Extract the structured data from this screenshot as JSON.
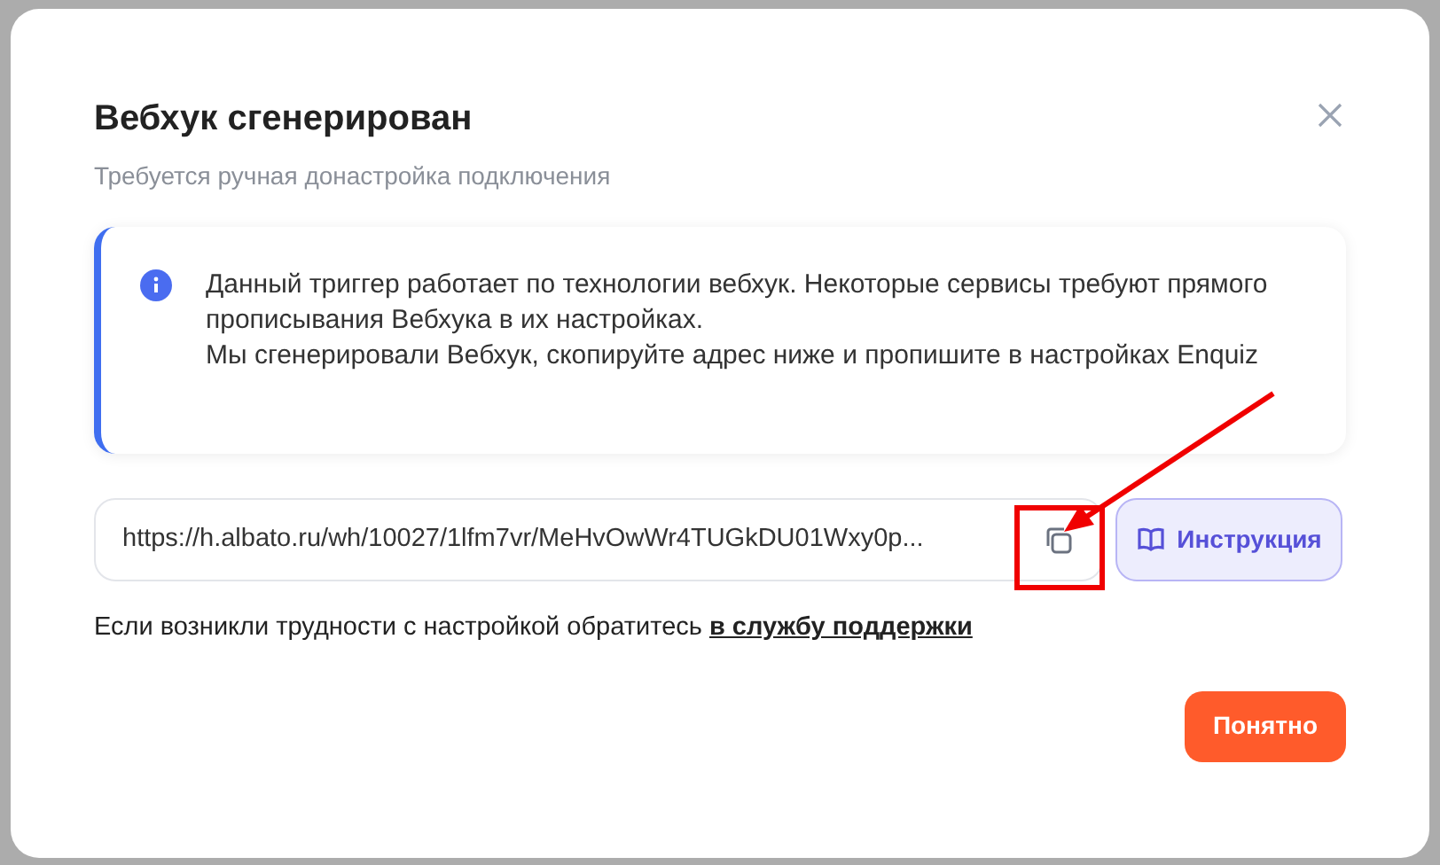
{
  "dialog": {
    "title": "Вебхук сгенерирован",
    "subtitle": "Требуется ручная донастройка подключения",
    "info": {
      "paragraphs": [
        "Данный триггер работает по технологии вебхук. Некоторые сервисы требуют прямого прописывания Вебхука в их настройках.",
        "Мы сгенерировали Вебхук, скопируйте адрес ниже и пропишите в настройках Enquiz"
      ]
    },
    "webhook_url": {
      "value": "https://h.albato.ru/wh/10027/1lfm7vr/MeHvOwWr4TUGkDU01Wxy0p..."
    },
    "instruction_button": "Инструкция",
    "help": {
      "text": "Если возникли трудности с настройкой обратитесь",
      "link": "в службу поддержки"
    },
    "confirm_button": "Понятно"
  }
}
